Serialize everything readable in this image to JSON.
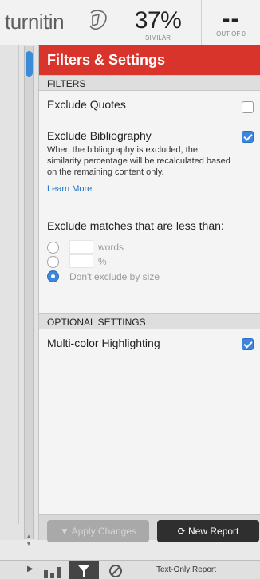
{
  "header": {
    "logo_text": "turnitin",
    "similarity_value": "37%",
    "similarity_label": "SIMILAR",
    "out_of_value": "--",
    "out_of_label": "OUT OF 0"
  },
  "panel": {
    "title": "Filters & Settings",
    "filters_header": "FILTERS",
    "exclude_quotes": {
      "label": "Exclude Quotes",
      "checked": false
    },
    "exclude_bibliography": {
      "label": "Exclude Bibliography",
      "checked": true,
      "help": "When the bibliography is excluded, the similarity percentage will be recalculated based on the remaining content only.",
      "learn_more": "Learn More"
    },
    "exclude_matches": {
      "label": "Exclude matches that are less than:",
      "options": [
        {
          "label": "words",
          "selected": false,
          "value": ""
        },
        {
          "label": "%",
          "selected": false,
          "value": ""
        },
        {
          "label": "Don't exclude by size",
          "selected": true
        }
      ]
    },
    "optional_header": "OPTIONAL SETTINGS",
    "multicolor": {
      "label": "Multi-color Highlighting",
      "checked": true
    },
    "apply_button": "Apply Changes",
    "new_report_button": "New Report"
  },
  "toolbar": {
    "text_only_report": "Text-Only Report"
  },
  "colors": {
    "accent_red": "#d9342b",
    "accent_blue": "#3d86dd"
  }
}
